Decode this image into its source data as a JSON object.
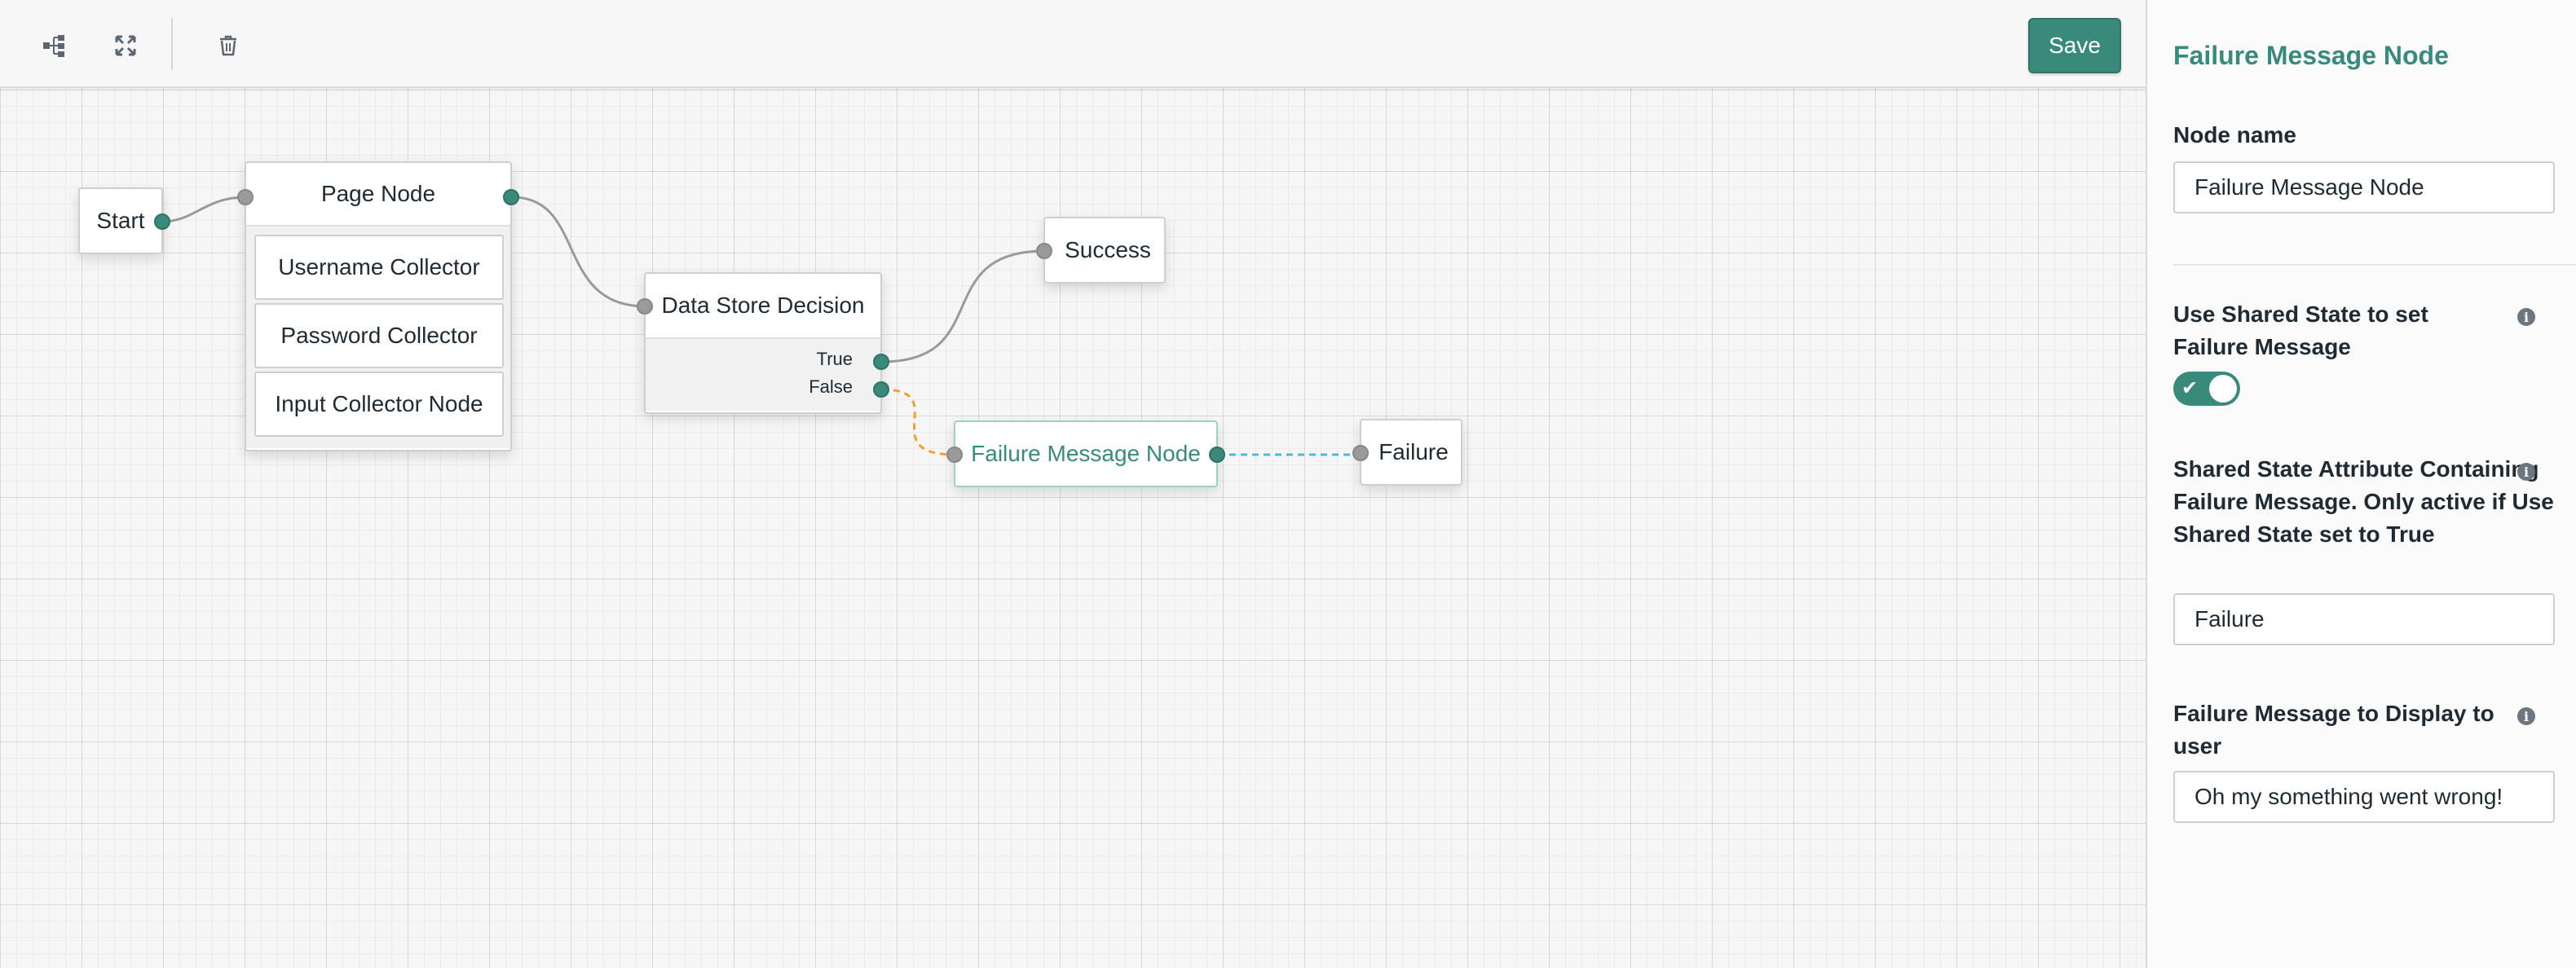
{
  "toolbar": {
    "save_label": "Save",
    "icons": [
      "tree-layout-icon",
      "fullscreen-icon",
      "trash-icon"
    ]
  },
  "canvas": {
    "nodes": {
      "start": "Start",
      "page_node": {
        "title": "Page Node",
        "children": [
          "Username Collector",
          "Password Collector",
          "Input Collector Node"
        ]
      },
      "data_store": {
        "title": "Data Store Decision",
        "outcomes": [
          "True",
          "False"
        ]
      },
      "success": "Success",
      "failure_message": "Failure Message Node",
      "failure": "Failure"
    },
    "colors": {
      "accent": "#3a8a7c",
      "false_edge": "#f0a030",
      "failure_edge": "#55b5d8",
      "edge": "#9a9a9a"
    }
  },
  "panel": {
    "title": "Failure Message Node",
    "node_name": {
      "label": "Node name",
      "value": "Failure Message Node"
    },
    "use_shared_state": {
      "label": "Use Shared State to set Failure Message",
      "enabled": true
    },
    "shared_state_attr": {
      "label": "Shared State Attribute Containing Failure Message. Only active if Use Shared State set to True",
      "value": "Failure"
    },
    "failure_message": {
      "label": "Failure Message to Display to user",
      "value": "Oh my something went wrong!"
    }
  }
}
